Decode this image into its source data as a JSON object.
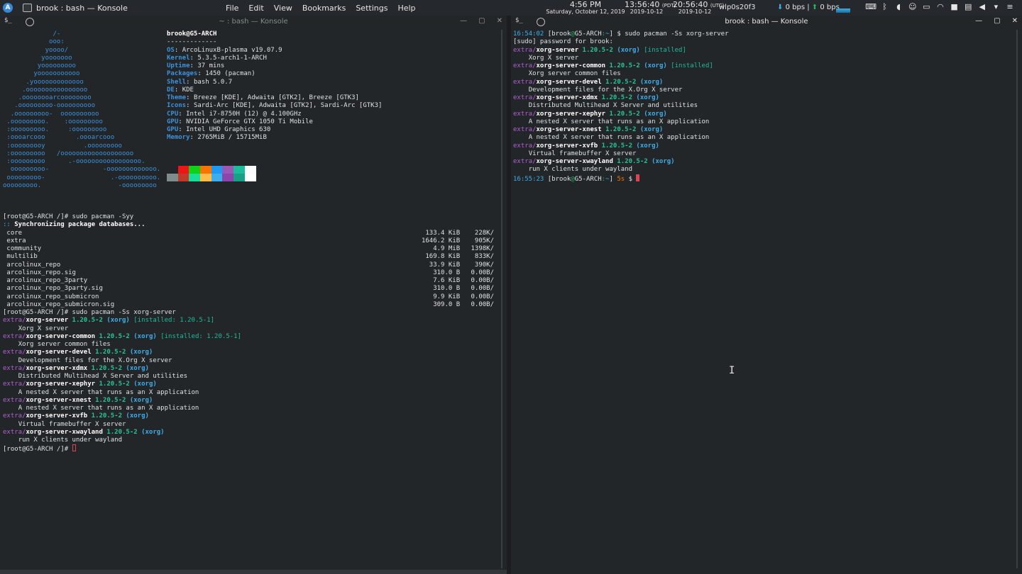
{
  "topbar": {
    "launcher_glyph": "A",
    "window_title": "brook : bash — Konsole",
    "menus": [
      "File",
      "Edit",
      "View",
      "Bookmarks",
      "Settings",
      "Help"
    ],
    "clock_time": "4:56 PM",
    "clock_date": "Saturday, October 12, 2019",
    "tz1_time": "13:56:40",
    "tz1_label": "(PDT)",
    "tz1_date": "2019-10-12",
    "tz2_time": "20:56:40",
    "tz2_label": "(UTC)",
    "tz2_date": "2019-10-12",
    "net_interface": "wlp0s20f3",
    "down_speed": "0 bps",
    "up_speed": "0 bps",
    "tray_icons": [
      "keyboard-icon",
      "bluetooth-icon",
      "volume-icon",
      "user-icon",
      "battery-icon",
      "wifi-icon",
      "lock-icon",
      "clipboard-icon",
      "speaker-icon",
      "chevron-down-icon",
      "menu-icon"
    ]
  },
  "left_window": {
    "title": "~ : bash — Konsole",
    "neofetch_logo": "             /-\n            ooo:\n           yoooo/\n          yooooooo\n         yooooooooo\n        yooooooooooo\n      .yooooooooooooo\n     .oooooooooooooooo\n    .oooooooarcoooooooo\n   .ooooooooo-oooooooooo\n  .ooooooooo-  oooooooooo\n .ooooooooo.    :ooooooooo\n :ooooooooo.     :ooooooooo\n :oooarcooo        .oooarcooo\n :ooooooooy          .ooooooooo\n :ooooooooo   /ooooooooooooooooooo\n :ooooooooo      .-ooooooooooooooooo.\n  ooooooooo-              -ooooooooooooo.\n ooooooooo-                 .-oooooooooo.\nooooooooo.                    -ooooooooo",
    "neofetch_user": "brook@G5-ARCH",
    "neofetch_sep": "-------------",
    "neofetch_info": [
      {
        "key": "OS",
        "value": "ArcoLinuxB-plasma v19.07.9"
      },
      {
        "key": "Kernel",
        "value": "5.3.5-arch1-1-ARCH"
      },
      {
        "key": "Uptime",
        "value": "37 mins"
      },
      {
        "key": "Packages",
        "value": "1450 (pacman)"
      },
      {
        "key": "Shell",
        "value": "bash 5.0.7"
      },
      {
        "key": "DE",
        "value": "KDE"
      },
      {
        "key": "Theme",
        "value": "Breeze [KDE], Adwaita [GTK2], Breeze [GTK3]"
      },
      {
        "key": "Icons",
        "value": "Sardi-Arc [KDE], Adwaita [GTK2], Sardi-Arc [GTK3]"
      },
      {
        "key": "CPU",
        "value": "Intel i7-8750H (12) @ 4.100GHz"
      },
      {
        "key": "GPU",
        "value": "NVIDIA GeForce GTX 1050 Ti Mobile"
      },
      {
        "key": "GPU",
        "value": "Intel UHD Graphics 630"
      },
      {
        "key": "Memory",
        "value": "2765MiB / 15715MiB"
      }
    ],
    "palette_top": [
      "#232629",
      "#ed1515",
      "#11d116",
      "#f67400",
      "#1d99f3",
      "#9b59b6",
      "#1abc9c",
      "#fcfcfc"
    ],
    "palette_bottom": [
      "#7f8c8d",
      "#c0392b",
      "#1cdc9a",
      "#fdbc4b",
      "#3daee9",
      "#8e44ad",
      "#16a085",
      "#ffffff"
    ],
    "sync_cmd": "[root@G5-ARCH /]# sudo pacman -Syy",
    "sync_header_prefix": "::",
    "sync_header": "Synchronizing package databases...",
    "db_rows": [
      {
        "name": "core",
        "size": "133.4 KiB",
        "rate": "228K/"
      },
      {
        "name": "extra",
        "size": "1646.2 KiB",
        "rate": "905K/"
      },
      {
        "name": "community",
        "size": "4.9 MiB",
        "rate": "1398K/"
      },
      {
        "name": "multilib",
        "size": "169.8 KiB",
        "rate": "833K/"
      },
      {
        "name": "arcolinux_repo",
        "size": "33.9 KiB",
        "rate": "390K/"
      },
      {
        "name": "arcolinux_repo.sig",
        "size": "310.0 B",
        "rate": "0.00B/"
      },
      {
        "name": "arcolinux_repo_3party",
        "size": "7.6 KiB",
        "rate": "0.00B/"
      },
      {
        "name": "arcolinux_repo_3party.sig",
        "size": "310.0 B",
        "rate": "0.00B/"
      },
      {
        "name": "arcolinux_repo_submicron",
        "size": "9.9 KiB",
        "rate": "0.00B/"
      },
      {
        "name": "arcolinux_repo_submicron.sig",
        "size": "309.0 B",
        "rate": "0.00B/"
      }
    ],
    "search_cmd": "[root@G5-ARCH /]# sudo pacman -Ss xorg-server",
    "results": [
      {
        "repo": "extra/",
        "pkg": "xorg-server",
        "ver": "1.20.5-2",
        "grp": "(xorg)",
        "installed": "[installed: 1.20.5-1]",
        "desc": "Xorg X server"
      },
      {
        "repo": "extra/",
        "pkg": "xorg-server-common",
        "ver": "1.20.5-2",
        "grp": "(xorg)",
        "installed": "[installed: 1.20.5-1]",
        "desc": "Xorg server common files"
      },
      {
        "repo": "extra/",
        "pkg": "xorg-server-devel",
        "ver": "1.20.5-2",
        "grp": "(xorg)",
        "installed": "",
        "desc": "Development files for the X.Org X server"
      },
      {
        "repo": "extra/",
        "pkg": "xorg-server-xdmx",
        "ver": "1.20.5-2",
        "grp": "(xorg)",
        "installed": "",
        "desc": "Distributed Multihead X Server and utilities"
      },
      {
        "repo": "extra/",
        "pkg": "xorg-server-xephyr",
        "ver": "1.20.5-2",
        "grp": "(xorg)",
        "installed": "",
        "desc": "A nested X server that runs as an X application"
      },
      {
        "repo": "extra/",
        "pkg": "xorg-server-xnest",
        "ver": "1.20.5-2",
        "grp": "(xorg)",
        "installed": "",
        "desc": "A nested X server that runs as an X application"
      },
      {
        "repo": "extra/",
        "pkg": "xorg-server-xvfb",
        "ver": "1.20.5-2",
        "grp": "(xorg)",
        "installed": "",
        "desc": "Virtual framebuffer X server"
      },
      {
        "repo": "extra/",
        "pkg": "xorg-server-xwayland",
        "ver": "1.20.5-2",
        "grp": "(xorg)",
        "installed": "",
        "desc": "run X clients under wayland"
      }
    ],
    "final_prompt": "[root@G5-ARCH /]# "
  },
  "right_window": {
    "title": "brook : bash — Konsole",
    "cmd_time": "16:54:02",
    "cmd_user": "[brook",
    "cmd_at": "@",
    "cmd_host": "G5-ARCH",
    "cmd_colon": ":",
    "cmd_tilde": "~",
    "cmd_close": "] $ ",
    "cmd_text": "sudo pacman -Ss xorg-server",
    "sudo_line": "[sudo] password for brook:",
    "results": [
      {
        "repo": "extra/",
        "pkg": "xorg-server",
        "ver": "1.20.5-2",
        "grp": "(xorg)",
        "installed": "[installed]",
        "desc": "Xorg X server"
      },
      {
        "repo": "extra/",
        "pkg": "xorg-server-common",
        "ver": "1.20.5-2",
        "grp": "(xorg)",
        "installed": "[installed]",
        "desc": "Xorg server common files"
      },
      {
        "repo": "extra/",
        "pkg": "xorg-server-devel",
        "ver": "1.20.5-2",
        "grp": "(xorg)",
        "installed": "",
        "desc": "Development files for the X.Org X server"
      },
      {
        "repo": "extra/",
        "pkg": "xorg-server-xdmx",
        "ver": "1.20.5-2",
        "grp": "(xorg)",
        "installed": "",
        "desc": "Distributed Multihead X Server and utilities"
      },
      {
        "repo": "extra/",
        "pkg": "xorg-server-xephyr",
        "ver": "1.20.5-2",
        "grp": "(xorg)",
        "installed": "",
        "desc": "A nested X server that runs as an X application"
      },
      {
        "repo": "extra/",
        "pkg": "xorg-server-xnest",
        "ver": "1.20.5-2",
        "grp": "(xorg)",
        "installed": "",
        "desc": "A nested X server that runs as an X application"
      },
      {
        "repo": "extra/",
        "pkg": "xorg-server-xvfb",
        "ver": "1.20.5-2",
        "grp": "(xorg)",
        "installed": "",
        "desc": "Virtual framebuffer X server"
      },
      {
        "repo": "extra/",
        "pkg": "xorg-server-xwayland",
        "ver": "1.20.5-2",
        "grp": "(xorg)",
        "installed": "",
        "desc": "run X clients under wayland"
      }
    ],
    "prompt_time": "16:55:23",
    "prompt_duration": "5s",
    "prompt_dollar": " $ "
  }
}
